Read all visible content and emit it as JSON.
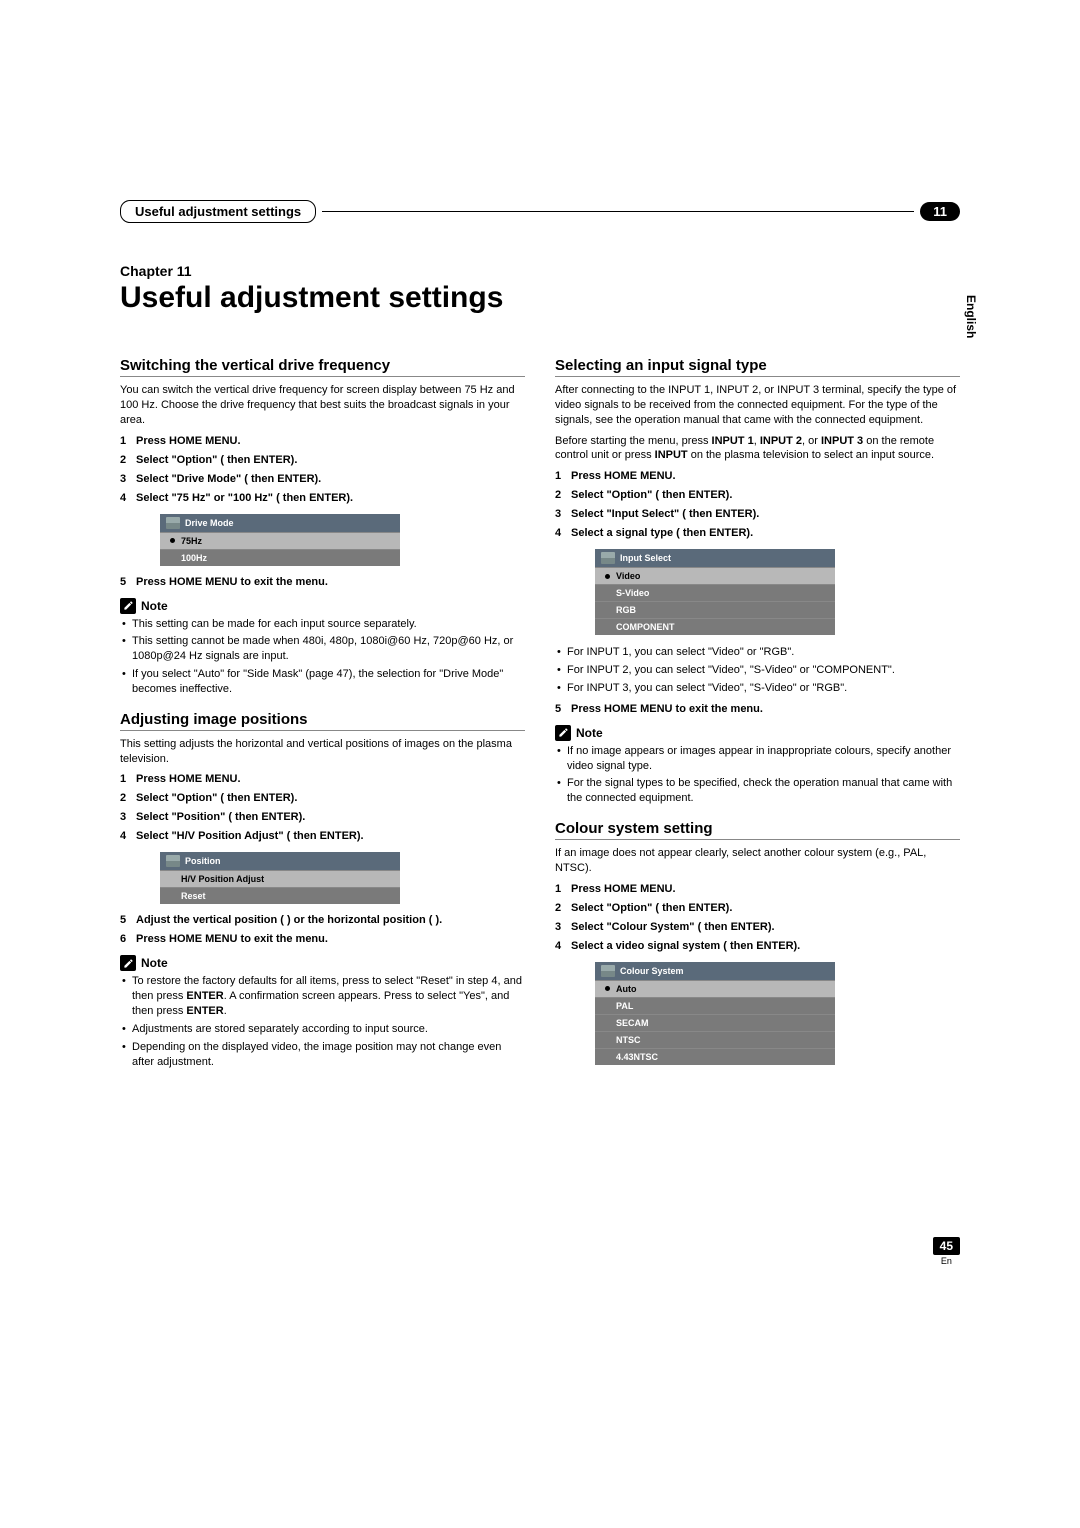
{
  "header": {
    "section_label": "Useful adjustment settings",
    "chapter_num": "11"
  },
  "side_lang": "English",
  "chapter": {
    "label": "Chapter 11",
    "title": "Useful adjustment settings"
  },
  "left": {
    "s1": {
      "title": "Switching the vertical drive frequency",
      "intro": "You can switch the vertical drive frequency for screen display between 75 Hz and 100 Hz. Choose the drive frequency that best suits the broadcast signals in your area.",
      "steps": {
        "1": "Press HOME MENU.",
        "2": "Select \"Option\" (  then ENTER).",
        "3": "Select \"Drive Mode\" (  then ENTER).",
        "4": "Select \"75 Hz\" or \"100 Hz\" (  then ENTER).",
        "5": "Press HOME MENU to exit the menu."
      },
      "menu": {
        "title": "Drive Mode",
        "r1": "75Hz",
        "r2": "100Hz"
      },
      "note_label": "Note",
      "notes": {
        "n1": "This setting can be made for each input source separately.",
        "n2": "This setting cannot be made when 480i, 480p, 1080i@60 Hz, 720p@60 Hz, or 1080p@24 Hz signals are input.",
        "n3": "If you select \"Auto\" for \"Side Mask\" (page 47), the selection for \"Drive Mode\" becomes ineffective."
      }
    },
    "s2": {
      "title": "Adjusting image positions",
      "intro": "This setting adjusts the horizontal and vertical positions of images on the plasma television.",
      "steps": {
        "1": "Press HOME MENU.",
        "2": "Select \"Option\" (  then ENTER).",
        "3": "Select \"Position\" (  then ENTER).",
        "4": "Select \"H/V Position Adjust\" (  then ENTER).",
        "5": "Adjust the vertical position (  ) or the horizontal position (  ).",
        "6": "Press HOME MENU to exit the menu."
      },
      "menu": {
        "title": "Position",
        "r1": "H/V Position Adjust",
        "r2": "Reset"
      },
      "note_label": "Note",
      "notes": {
        "n1_a": "To restore the factory defaults for all items, press   to select \"Reset\" in step 4, and then press ",
        "n1_b": "ENTER",
        "n1_c": ". A confirmation screen appears. Press   to select \"Yes\", and then press ",
        "n1_d": "ENTER",
        "n1_e": ".",
        "n2": "Adjustments are stored separately according to input source.",
        "n3": "Depending on the displayed video, the image position may not change even after adjustment."
      }
    }
  },
  "right": {
    "s1": {
      "title": "Selecting an input signal type",
      "intro": "After connecting to the INPUT 1, INPUT 2, or INPUT 3 terminal, specify the type of video signals to be received from the connected equipment. For the type of the signals, see the operation manual that came with the connected equipment.",
      "pre_a": "Before starting the menu, press ",
      "pre_b": "INPUT 1",
      "pre_c": ", ",
      "pre_d": "INPUT 2",
      "pre_e": ", or ",
      "pre_f": "INPUT 3",
      "pre_g": " on the remote control unit or press ",
      "pre_h": "INPUT",
      "pre_i": " on the plasma television to select an input source.",
      "steps": {
        "1": "Press HOME MENU.",
        "2": "Select \"Option\" (  then ENTER).",
        "3": "Select \"Input Select\" (  then ENTER).",
        "4": "Select a signal type (  then ENTER).",
        "5": "Press HOME MENU to exit the menu."
      },
      "menu": {
        "title": "Input Select",
        "r1": "Video",
        "r2": "S-Video",
        "r3": "RGB",
        "r4": "COMPONENT"
      },
      "mid_notes": {
        "n1": "For INPUT 1, you can select \"Video\" or \"RGB\".",
        "n2": "For INPUT 2, you can select \"Video\", \"S-Video\" or \"COMPONENT\".",
        "n3": "For INPUT 3, you can select \"Video\", \"S-Video\" or \"RGB\"."
      },
      "note_label": "Note",
      "notes": {
        "n1": "If no image appears or images appear in inappropriate colours, specify another video signal type.",
        "n2": "For the signal types to be specified, check the operation manual that came with the connected equipment."
      }
    },
    "s2": {
      "title": "Colour system setting",
      "intro": "If an image does not appear clearly, select another colour system (e.g., PAL, NTSC).",
      "steps": {
        "1": "Press HOME MENU.",
        "2": "Select \"Option\" (  then ENTER).",
        "3": "Select \"Colour System\" (  then ENTER).",
        "4": "Select a video signal system (  then ENTER)."
      },
      "menu": {
        "title": "Colour System",
        "r1": "Auto",
        "r2": "PAL",
        "r3": "SECAM",
        "r4": "NTSC",
        "r5": "4.43NTSC"
      }
    }
  },
  "footer": {
    "page_num": "45",
    "lang": "En"
  }
}
